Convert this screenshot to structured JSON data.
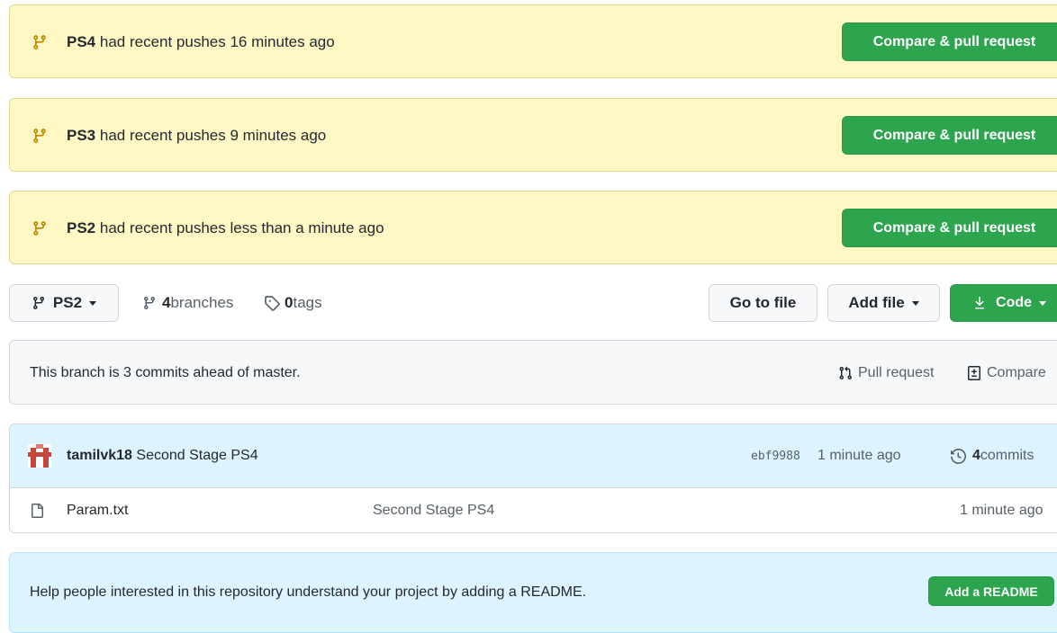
{
  "flashes": [
    {
      "branch": "PS4",
      "text": " had recent pushes 16 minutes ago",
      "button": "Compare & pull request"
    },
    {
      "branch": "PS3",
      "text": " had recent pushes 9 minutes ago",
      "button": "Compare & pull request"
    },
    {
      "branch": "PS2",
      "text": " had recent pushes less than a minute ago",
      "button": "Compare & pull request"
    }
  ],
  "toolbar": {
    "branch_select": "PS2",
    "branches_count": "4",
    "branches_label": " branches",
    "tags_count": "0",
    "tags_label": " tags",
    "go_to_file": "Go to file",
    "add_file": "Add file",
    "code": "Code"
  },
  "branch_info": {
    "text": "This branch is 3 commits ahead of master.",
    "pull_request": "Pull request",
    "compare": "Compare"
  },
  "commit": {
    "author": "tamilvk18",
    "message": "Second Stage PS4",
    "sha": "ebf9988",
    "time": "1 minute ago",
    "commits_count": "4",
    "commits_label": " commits"
  },
  "files": [
    {
      "name": "Param.txt",
      "message": "Second Stage PS4",
      "time": "1 minute ago"
    }
  ],
  "readme": {
    "text": "Help people interested in this repository understand your project by adding a README.",
    "button": "Add a README"
  },
  "colors": {
    "green": "#2da44e",
    "flash_bg": "#fff8c5",
    "branch_icon": "#bf8700"
  }
}
